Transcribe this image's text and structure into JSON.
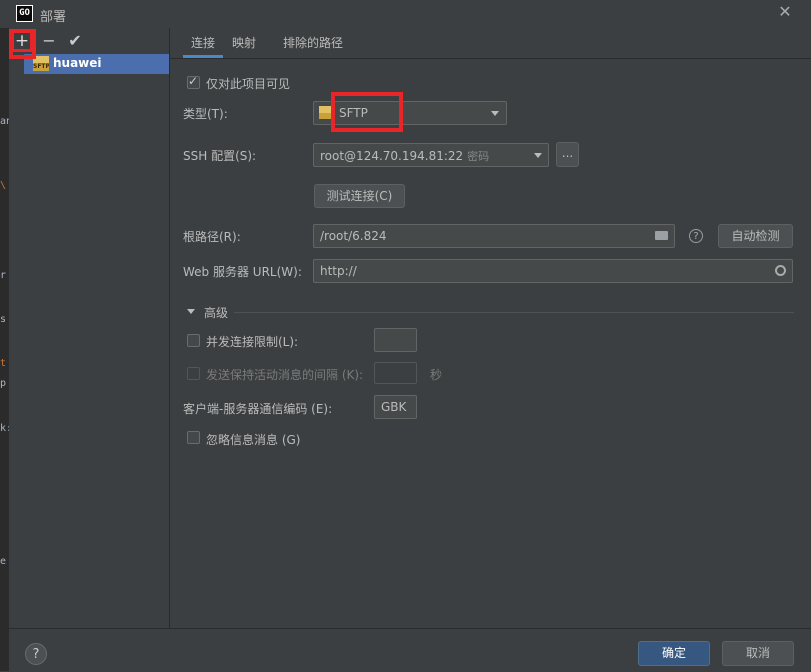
{
  "window": {
    "title": "部署",
    "app_icon_text": "GO",
    "close_glyph": "✕"
  },
  "toolbar": {
    "add_glyph": "+",
    "remove_glyph": "−",
    "apply_glyph": "✔"
  },
  "servers": [
    {
      "name": "huawei",
      "icon_text": "SFTP"
    }
  ],
  "tabs": [
    {
      "label": "连接",
      "active": true
    },
    {
      "label": "映射",
      "active": false
    },
    {
      "label": "排除的路径",
      "active": false
    }
  ],
  "form": {
    "visible_only_label": "仅对此项目可见",
    "visible_only_checked": true,
    "type_label": "类型(T):",
    "type_value": "SFTP",
    "ssh_label": "SSH 配置(S):",
    "ssh_value": "root@124.70.194.81:22",
    "ssh_hint": "密码",
    "ssh_more": "...",
    "test_button": "测试连接(C)",
    "root_label": "根路径(R):",
    "root_value": "/root/6.824",
    "auto_detect": "自动检测",
    "help_glyph": "?",
    "web_url_label": "Web 服务器 URL(W):",
    "web_url_value": "http://"
  },
  "advanced": {
    "header": "高级",
    "concurrent_label": "并发连接限制(L):",
    "concurrent_value": "",
    "keepalive_label": "发送保持活动消息的间隔 (K):",
    "keepalive_value": "",
    "keepalive_unit": "秒",
    "encoding_label": "客户端-服务器通信编码 (E):",
    "encoding_value": "GBK",
    "ignore_label": "忽略信息消息 (G)"
  },
  "footer": {
    "ok": "确定",
    "cancel": "取消",
    "help": "?"
  },
  "strip_chars": [
    "an",
    "\\",
    "r",
    "s",
    "t",
    "p",
    "k:",
    "e"
  ],
  "colors": {
    "accent": "#4b6eaf",
    "highlight": "#e8262a",
    "primary_button": "#365880"
  }
}
